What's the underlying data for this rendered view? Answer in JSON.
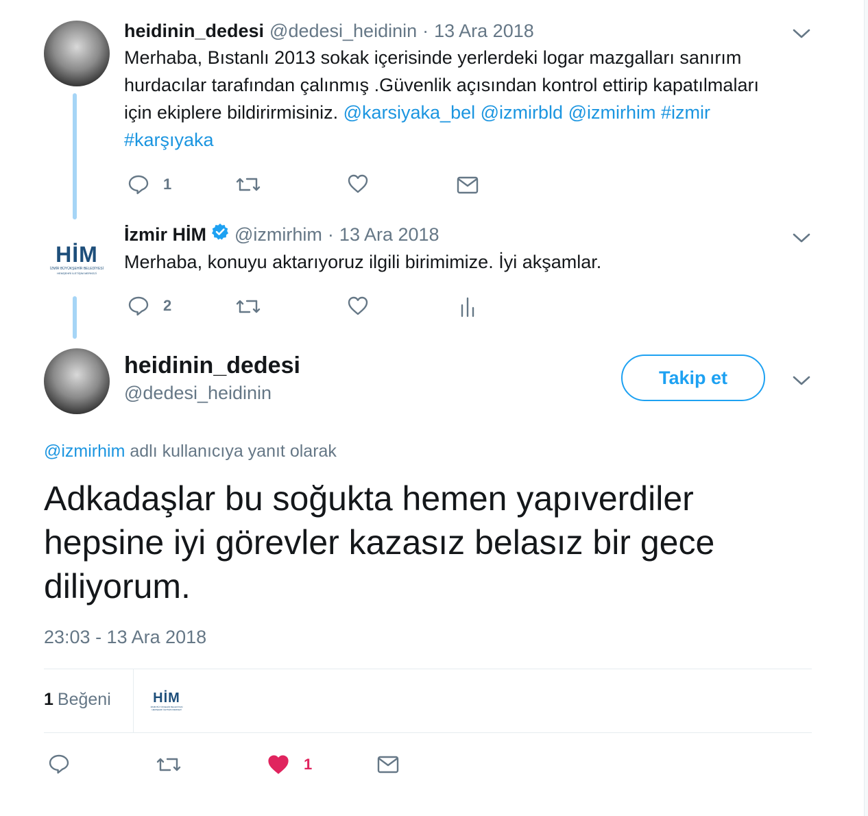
{
  "tweets": [
    {
      "author_name": "heidinin_dedesi",
      "handle": "@dedesi_heidinin",
      "separator": "·",
      "date": "13 Ara 2018",
      "text_line1": "Merhaba, Bıstanlı 2013 sokak içerisinde yerlerdeki logar mazgalları sanırım",
      "text_line2": "hurdacılar tarafından çalınmış .Güvenlik açısından kontrol ettirip kapatılmaları",
      "text_line3_prefix": "için ekiplere bildirirmisiniz.",
      "mention_1": "@karsiyaka_bel",
      "mention_2": "@izmirbld",
      "mention_3": "@izmirhim",
      "hashtag_1": "#izmir",
      "hashtag_2": "#karşıyaka",
      "reply_count": "1",
      "icons": [
        "reply-icon",
        "retweet-icon",
        "like-icon",
        "message-icon"
      ]
    },
    {
      "author_name": "İzmir HİM",
      "verified": true,
      "handle": "@izmirhim",
      "separator": "·",
      "date": "13 Ara 2018",
      "text": "Merhaba, konuyu aktarıyoruz  ilgili birimimize. İyi akşamlar.",
      "reply_count": "2",
      "icons": [
        "reply-icon",
        "retweet-icon",
        "like-icon",
        "analytics-icon"
      ]
    }
  ],
  "him_logo": {
    "letters": "HİM",
    "subtitle_1": "İZMİR BÜYÜKŞEHİR BELEDİYESİ",
    "subtitle_2": "HEMŞEHRİ İLETİŞİM MERKEZİ"
  },
  "focus_tweet": {
    "author_name": "heidinin_dedesi",
    "handle": "@dedesi_heidinin",
    "follow_label": "Takip et",
    "reply_to_mention": "@izmirhim",
    "reply_to_suffix": " adlı kullanıcıya yanıt olarak",
    "text": "Adkadaşlar bu soğukta hemen yapıverdiler hepsine iyi görevler kazasız belasız bir gece diliyorum.",
    "timestamp": "23:03 - 13 Ara 2018",
    "likes_count": "1",
    "likes_label": "Beğeni",
    "like_count_action": "1",
    "icons": [
      "reply-icon",
      "retweet-icon",
      "liked-heart-icon",
      "message-icon"
    ]
  },
  "colors": {
    "link": "#1b95e0",
    "follow": "#1da1f2",
    "thread_line": "#a6d5f6",
    "like": "#e0245e",
    "muted": "#657786"
  }
}
